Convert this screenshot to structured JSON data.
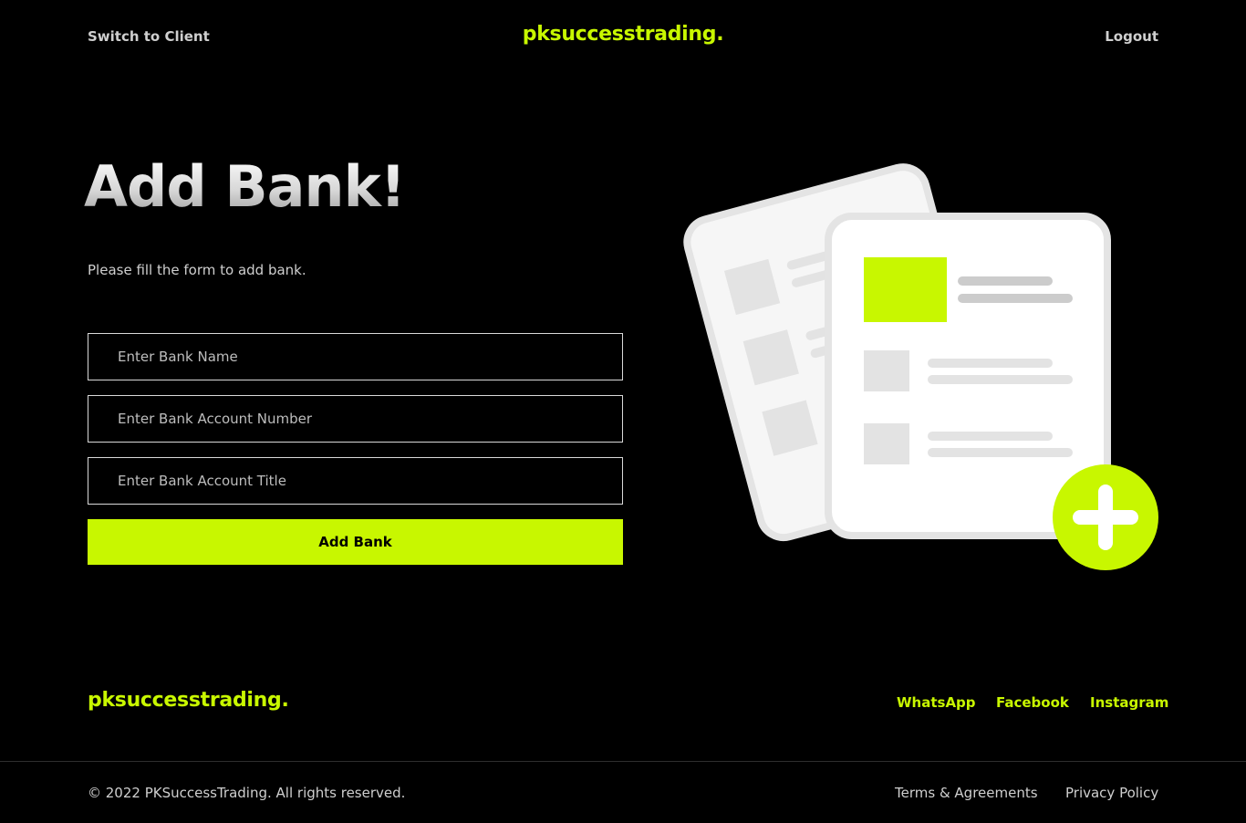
{
  "header": {
    "switch_label": "Switch to Client",
    "brand": "pksuccesstrading.",
    "logout_label": "Logout"
  },
  "main": {
    "heading": "Add Bank!",
    "subtext": "Please fill the form to add bank.",
    "fields": [
      {
        "placeholder": "Enter Bank Name",
        "value": ""
      },
      {
        "placeholder": "Enter Bank Account Number",
        "value": ""
      },
      {
        "placeholder": "Enter Bank Account Title",
        "value": ""
      }
    ],
    "submit_label": "Add Bank"
  },
  "illustration": {
    "icons": [
      "document-stack-icon",
      "plus-circle-icon"
    ]
  },
  "footer": {
    "brand": "pksuccesstrading.",
    "social": [
      "WhatsApp",
      "Facebook",
      "Instagram"
    ],
    "copyright": "© 2022 PKSuccessTrading. All rights reserved.",
    "legal": [
      "Terms & Agreements",
      "Privacy Policy"
    ]
  },
  "colors": {
    "accent": "#c8f700",
    "background": "#000000",
    "muted_text": "#cfcfcf"
  }
}
